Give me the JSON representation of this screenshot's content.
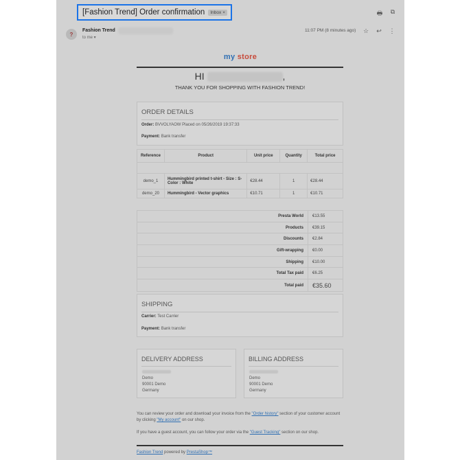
{
  "header": {
    "subject": "[Fashion Trend] Order confirmation",
    "inbox_label": "Inbox",
    "inbox_close": "×",
    "print_icon": "🖶",
    "popout_icon": "⧉"
  },
  "message": {
    "avatar_initial": "?",
    "sender_name": "Fashion Trend",
    "to_me": "to me ▾",
    "time": "11:07 PM (8 minutes ago)",
    "star_icon": "☆",
    "reply_icon": "↩",
    "more_icon": "⋮"
  },
  "email": {
    "logo_part1": "my",
    "logo_part2": "store",
    "greeting": "HI",
    "greeting_comma": ",",
    "thanks": "THANK YOU FOR SHOPPING WITH FASHION TREND!",
    "order_details": {
      "title": "ORDER DETAILS",
      "order_label": "Order:",
      "order_value": "BVVOLYAOW Placed on 05/26/2019 19:37:33",
      "payment_label": "Payment:",
      "payment_value": "Bank transfer"
    },
    "items_table": {
      "headers": [
        "Reference",
        "Product",
        "Unit price",
        "Quantity",
        "Total price"
      ],
      "rows": [
        {
          "reference": "demo_1",
          "product": "Hummingbird printed t-shirt - Size : S- Color : White",
          "unit_price": "€28.44",
          "quantity": "1",
          "total": "€28.44"
        },
        {
          "reference": "demo_20",
          "product": "Hummingbird - Vector graphics",
          "unit_price": "€10.71",
          "quantity": "1",
          "total": "€10.71"
        }
      ]
    },
    "totals": [
      {
        "label": "Presta World",
        "value": "€13.55"
      },
      {
        "label": "Products",
        "value": "€39.15"
      },
      {
        "label": "Discounts",
        "value": "€2.84"
      },
      {
        "label": "Gift-wrapping",
        "value": "€0.00"
      },
      {
        "label": "Shipping",
        "value": "€10.00"
      },
      {
        "label": "Total Tax paid",
        "value": "€6.25"
      },
      {
        "label": "Total paid",
        "value": "€35.60"
      }
    ],
    "shipping": {
      "title": "SHIPPING",
      "carrier_label": "Carrier:",
      "carrier_value": "Test Carrier",
      "payment_label": "Payment:",
      "payment_value": "Bank transfer"
    },
    "delivery": {
      "title": "DELIVERY ADDRESS",
      "lines": [
        "Demo",
        "90001 Demo",
        "Germany"
      ]
    },
    "billing": {
      "title": "BILLING ADDRESS",
      "lines": [
        "Demo",
        "90001 Demo",
        "Germany"
      ]
    },
    "footer": {
      "p1_a": "You can review your order and download your invoice from the ",
      "p1_link1": "\"Order history\"",
      "p1_b": " section of your customer account by clicking ",
      "p1_link2": "\"My account\"",
      "p1_c": " on our shop.",
      "p2_a": "If you have a guest account, you can follow your order via the ",
      "p2_link": "\"Guest Tracking\"",
      "p2_b": " section on our shop.",
      "brand_link": "Fashion Trend",
      "powered": " powered by ",
      "presta_link": "PrestaShop™"
    }
  }
}
